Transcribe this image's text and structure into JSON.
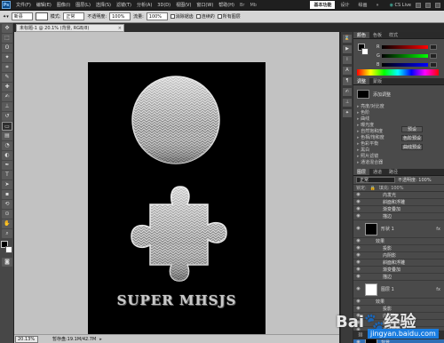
{
  "app": {
    "logo": "Ps",
    "menu": [
      "文件(F)",
      "编辑(E)",
      "图像(I)",
      "图层(L)",
      "选择(S)",
      "滤镜(T)",
      "分析(A)",
      "3D(D)",
      "视图(V)",
      "窗口(W)",
      "帮助(H)"
    ],
    "menu_extras": [
      "Br",
      "Mb"
    ],
    "workspace_tabs": [
      "基本功能",
      "设计",
      "绘画",
      "»"
    ],
    "cs_live": "CS Live"
  },
  "options": {
    "preset_label": "新县",
    "mode_label": "模式:",
    "mode_value": "正常",
    "opacity_label": "不透明度:",
    "opacity_value": "100%",
    "flow_label": "流量:",
    "flow_value": "100%",
    "check1_label": "消除锯齿",
    "check2_label": "连续的",
    "check3_label": "所有图层"
  },
  "document": {
    "tab_title": "未标题-1 @ 20.1% (背景, RGB/8)",
    "heading": "SUPER MHSJS"
  },
  "status": {
    "zoom": "20.13%",
    "info": "暂存盘:19.1M/42.7M"
  },
  "color_panel": {
    "tabs": [
      "颜色",
      "色板",
      "样式"
    ],
    "sliders": [
      {
        "label": "R",
        "color": "#e23b3b"
      },
      {
        "label": "G",
        "color": "#3bb83b"
      },
      {
        "label": "B",
        "color": "#3b5fe2"
      }
    ]
  },
  "adjust_panel": {
    "tabs": [
      "调整",
      "蒙版"
    ],
    "title": "添加调整",
    "items": [
      "亮度/对比度",
      "色阶",
      "曲线",
      "曝光度",
      "自然饱和度",
      "色相/饱和度",
      "色彩平衡",
      "黑白",
      "照片滤镜",
      "通道混合器"
    ],
    "buttons": [
      "预设",
      "色阶预设",
      "曲线预设"
    ]
  },
  "layers_panel": {
    "tabs": [
      "图层",
      "通道",
      "路径"
    ],
    "mode": "正常",
    "opacity": "不透明度: 100%",
    "lock": "锁定:",
    "fill": "填充: 100%",
    "rows": [
      {
        "name": "内发光",
        "indent": 2,
        "type": "effect"
      },
      {
        "name": "斜面和浮雕",
        "indent": 2,
        "type": "effect"
      },
      {
        "name": "渐变叠加",
        "indent": 2,
        "type": "effect"
      },
      {
        "name": "描边",
        "indent": 2,
        "type": "effect"
      },
      {
        "name": "形状 1",
        "indent": 0,
        "type": "layer",
        "thumb": "black",
        "fx": "fx"
      },
      {
        "name": "效果",
        "indent": 1,
        "type": "effect"
      },
      {
        "name": "投影",
        "indent": 2,
        "type": "effect"
      },
      {
        "name": "内阴影",
        "indent": 2,
        "type": "effect"
      },
      {
        "name": "斜面和浮雕",
        "indent": 2,
        "type": "effect"
      },
      {
        "name": "渐变叠加",
        "indent": 2,
        "type": "effect"
      },
      {
        "name": "描边",
        "indent": 2,
        "type": "effect"
      },
      {
        "name": "图层 1",
        "indent": 0,
        "type": "layer",
        "thumb": "white",
        "fx": "fx"
      },
      {
        "name": "效果",
        "indent": 1,
        "type": "effect"
      },
      {
        "name": "投影",
        "indent": 2,
        "type": "effect"
      },
      {
        "name": "内阴影",
        "indent": 2,
        "type": "effect"
      },
      {
        "name": "斜面和浮雕",
        "indent": 2,
        "type": "effect"
      },
      {
        "name": "渐变叠加",
        "indent": 2,
        "type": "effect"
      },
      {
        "name": "背景",
        "indent": 0,
        "type": "layer",
        "thumb": "black",
        "fx": "",
        "selected": true
      }
    ]
  },
  "watermark": {
    "text": "Bai🐾经验",
    "sub": "jingyan.baidu.com"
  }
}
